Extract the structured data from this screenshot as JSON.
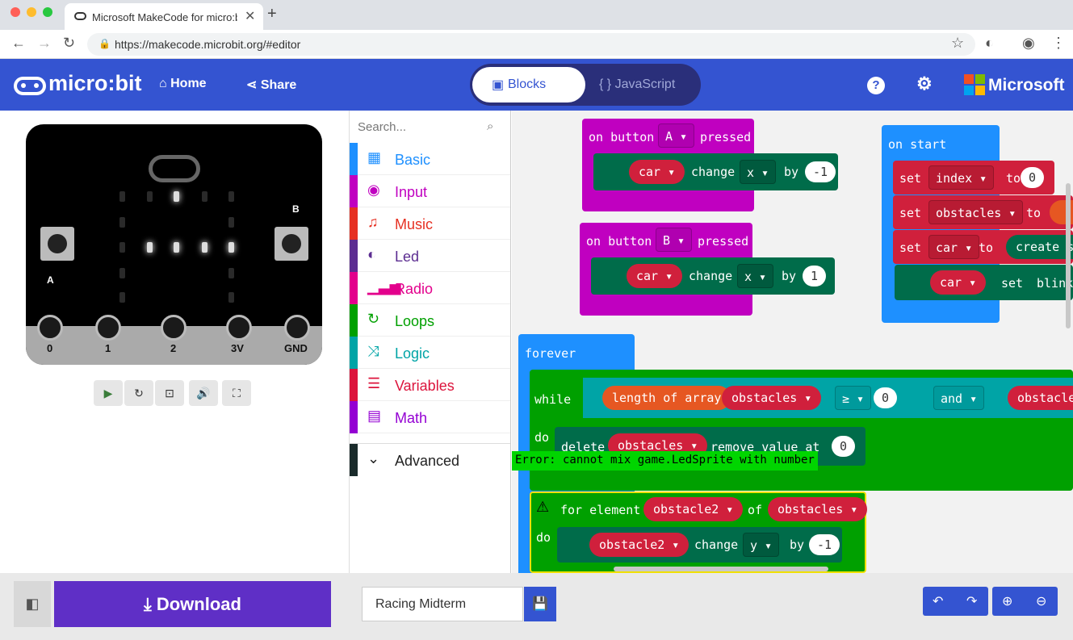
{
  "browser": {
    "tab_title": "Microsoft MakeCode for micro:bit",
    "url": "https://makecode.microbit.org/#editor"
  },
  "header": {
    "logo": "micro:bit",
    "home": "Home",
    "share": "Share",
    "blocks": "Blocks",
    "javascript": "{ } JavaScript",
    "brand": "Microsoft"
  },
  "sim": {
    "pins": [
      "0",
      "1",
      "2",
      "3V",
      "GND"
    ],
    "btn_a": "A",
    "btn_b": "B"
  },
  "toolbox": {
    "search_placeholder": "Search...",
    "categories": [
      "Basic",
      "Input",
      "Music",
      "Led",
      "Radio",
      "Loops",
      "Logic",
      "Variables",
      "Math"
    ],
    "advanced": "Advanced"
  },
  "blocks": {
    "btnA": {
      "on": "on button",
      "key": "A ▾",
      "pressed": "pressed",
      "var": "car ▾",
      "change": "change",
      "prop": "x ▾",
      "by": "by",
      "val": "-1"
    },
    "btnB": {
      "on": "on button",
      "key": "B ▾",
      "pressed": "pressed",
      "var": "car ▾",
      "change": "change",
      "prop": "x ▾",
      "by": "by",
      "val": "1"
    },
    "start": {
      "title": "on start",
      "set": "set",
      "v1": "index ▾",
      "to": "to",
      "n1": "0",
      "v2": "obstacles ▾",
      "v3": "car ▾",
      "create": "create s",
      "v4": "car ▾",
      "setw": "set",
      "blink": "blink"
    },
    "forever": {
      "title": "forever",
      "while": "while",
      "length": "length of array",
      "obstacles": "obstacles ▾",
      "op": "≥ ▾",
      "zero": "0",
      "and": "and ▾",
      "obst2": "obstacle",
      "do": "do",
      "delete": "delete",
      "removeval": "remove value at",
      "rv": "0"
    },
    "foreach": {
      "for": "for element",
      "var": "obstacle2 ▾",
      "of": "of",
      "list": "obstacles ▾",
      "do": "do",
      "v": "obstacle2 ▾",
      "change": "change",
      "prop": "y ▾",
      "by": "by",
      "val": "-1"
    },
    "error": "Error: cannot mix game.LedSprite with number"
  },
  "bottom": {
    "download": "Download",
    "project": "Racing Midterm"
  },
  "colors": {
    "header": "#3454d1",
    "event": "#c000c0",
    "sprite": "#006c4a",
    "variable": "#d0203c",
    "loop": "#00a000",
    "logic": "#00a4a6",
    "start": "#1e90ff"
  }
}
